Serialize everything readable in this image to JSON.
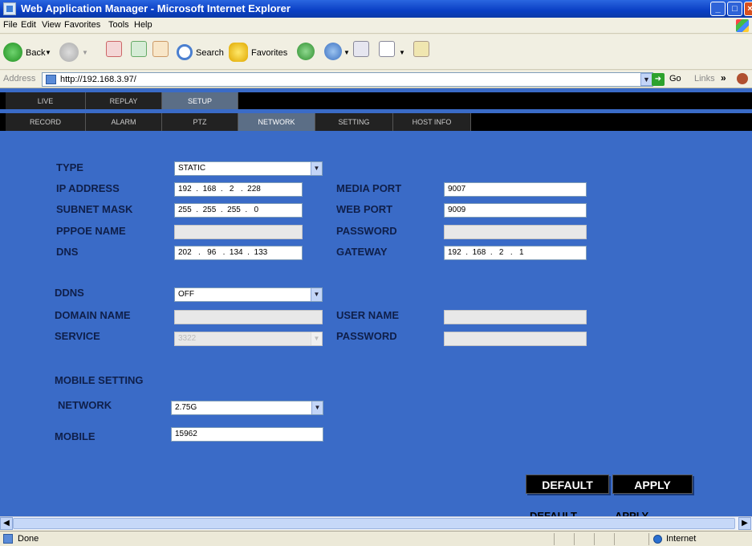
{
  "window": {
    "title": "Web Application Manager - Microsoft Internet Explorer"
  },
  "menu": [
    "File",
    "Edit",
    "View",
    "Favorites",
    "Tools",
    "Help"
  ],
  "toolbar": {
    "back": "Back",
    "search": "Search",
    "favorites": "Favorites"
  },
  "address": {
    "label": "Address",
    "url": "http://192.168.3.97/",
    "go": "Go",
    "links": "Links"
  },
  "nav": {
    "main_tabs": [
      "LIVE",
      "REPLAY",
      "SETUP"
    ],
    "sub_tabs": [
      "RECORD",
      "ALARM",
      "PTZ",
      "NETWORK",
      "SETTING",
      "HOST INFO"
    ]
  },
  "network": {
    "type_label": "TYPE",
    "type_value": "STATIC",
    "ip_label": "IP ADDRESS",
    "ip_value": "192  .  168  .   2   .  228",
    "subnet_label": "SUBNET MASK",
    "subnet_value": "255  .  255  .  255  .   0",
    "pppoe_label": "PPPOE NAME",
    "pppoe_value": "",
    "dns_label": "DNS",
    "dns_value": "202   .   96   .  134  .  133",
    "media_port_label": "MEDIA PORT",
    "media_port_value": "9007",
    "web_port_label": "WEB PORT",
    "web_port_value": "9009",
    "password_label": "PASSWORD",
    "password_value": "",
    "gateway_label": "GATEWAY",
    "gateway_value": "192  .  168  .   2   .   1"
  },
  "ddns": {
    "ddns_label": "DDNS",
    "ddns_value": "OFF",
    "domain_label": "DOMAIN NAME",
    "domain_value": "",
    "service_label": "SERVICE",
    "service_value": "3322",
    "user_label": "USER NAME",
    "user_value": "",
    "password_label": "PASSWORD",
    "password_value": ""
  },
  "mobile": {
    "heading": "MOBILE SETTING",
    "network_label": "NETWORK",
    "network_value": "2.75G",
    "mobile_label": "MOBILE",
    "mobile_value": "15962"
  },
  "buttons": {
    "default": "DEFAULT",
    "apply": "APPLY"
  },
  "status": {
    "text": "Done",
    "zone": "Internet"
  }
}
